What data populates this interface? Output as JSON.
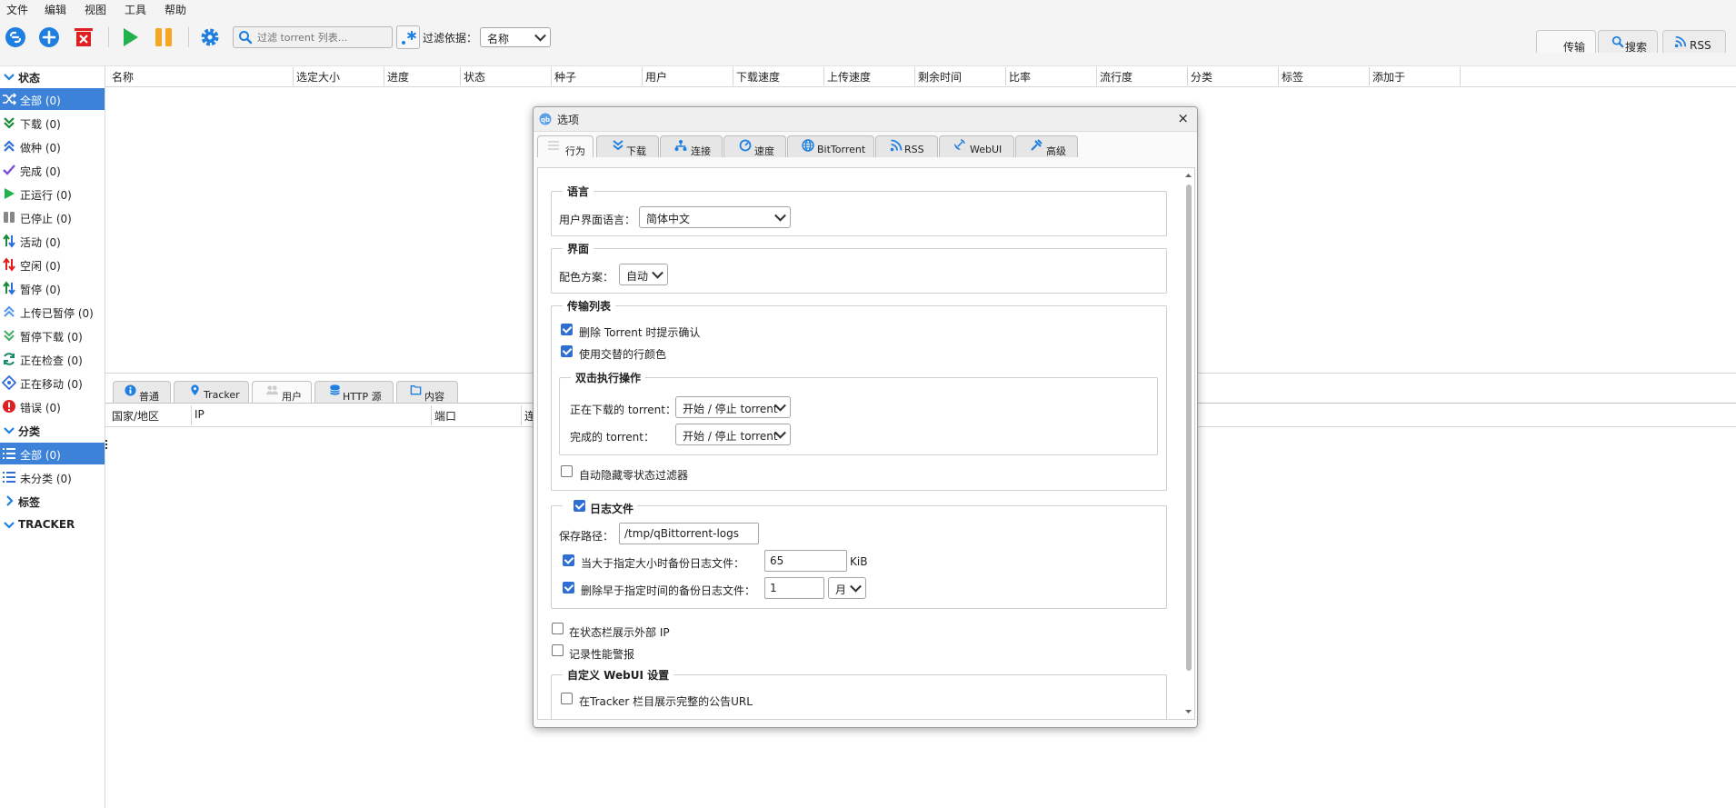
{
  "menu": [
    "文件",
    "编辑",
    "视图",
    "工具",
    "帮助"
  ],
  "toolbar": {
    "search_placeholder": "过滤 torrent 列表...",
    "filter_by_label": "过滤依据：",
    "filter_by_value": "名称",
    "regex_symbol": ".*"
  },
  "right_tabs": [
    "传输",
    "搜索",
    "RSS"
  ],
  "left_panel": {
    "status_header": "状态",
    "status_items": [
      "全部 (0)",
      "下载 (0)",
      "做种 (0)",
      "完成 (0)",
      "正运行 (0)",
      "已停止 (0)",
      "活动 (0)",
      "空闲 (0)",
      "暂停 (0)",
      "上传已暂停 (0)",
      "暂停下载 (0)",
      "正在检查 (0)",
      "正在移动 (0)",
      "错误 (0)"
    ],
    "category_header": "分类",
    "category_items": [
      "全部 (0)",
      "未分类 (0)"
    ],
    "tags_header": "标签",
    "tracker_header": "TRACKER"
  },
  "table_columns": [
    "名称",
    "选定大小",
    "进度",
    "状态",
    "种子",
    "用户",
    "下载速度",
    "上传速度",
    "剩余时间",
    "比率",
    "流行度",
    "分类",
    "标签",
    "添加于"
  ],
  "bottom_tabs": [
    "普通",
    "Tracker",
    "用户",
    "HTTP 源",
    "内容"
  ],
  "peer_columns": [
    "国家/地区",
    "IP",
    "端口",
    "连"
  ],
  "dialog": {
    "title": "选项",
    "close": "×",
    "tabs": [
      "行为",
      "下载",
      "连接",
      "速度",
      "BitTorrent",
      "RSS",
      "WebUI",
      "高级"
    ],
    "language": {
      "legend": "语言",
      "ui_language_label": "用户界面语言：",
      "ui_language_value": "简体中文"
    },
    "interface": {
      "legend": "界面",
      "color_scheme_label": "配色方案：",
      "color_scheme_value": "自动"
    },
    "transfer_list": {
      "legend": "传输列表",
      "confirm_delete": "删除 Torrent 时提示确认",
      "alt_row_colors": "使用交替的行颜色",
      "double_click": {
        "legend": "双击执行操作",
        "downloading_label": "正在下载的 torrent：",
        "downloading_value": "开始 / 停止 torrent",
        "completed_label": "完成的 torrent：",
        "completed_value": "开始 / 停止 torrent"
      },
      "hide_zero_filters": "自动隐藏零状态过滤器"
    },
    "log_file": {
      "legend": "日志文件",
      "save_path_label": "保存路径：",
      "save_path_value": "/tmp/qBittorrent-logs",
      "backup_size_label": "当大于指定大小时备份日志文件：",
      "backup_size_value": "65",
      "backup_size_unit": "KiB",
      "delete_older_label": "删除早于指定时间的备份日志文件：",
      "delete_older_value": "1",
      "delete_older_unit": "月"
    },
    "show_external_ip": "在状态栏展示外部 IP",
    "perf_warnings": "记录性能警报",
    "custom_webui": {
      "legend": "自定义 WebUI 设置",
      "full_tracker_url": "在Tracker 栏目展示完整的公告URL"
    }
  },
  "colors": {
    "accent": "#3b82d8",
    "start_green": "#22b14c",
    "pause_orange": "#f5a623",
    "delete_red": "#e02020"
  }
}
